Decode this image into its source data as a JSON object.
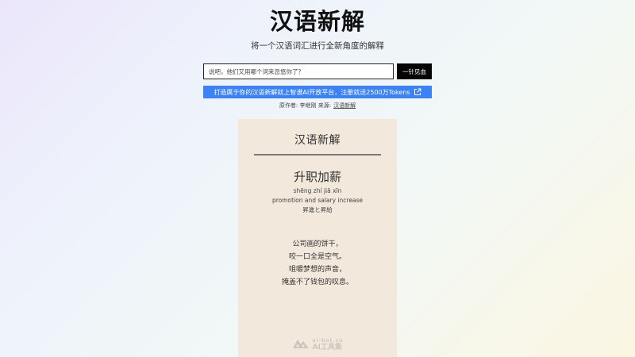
{
  "header": {
    "title": "汉语新解",
    "subtitle": "将一个汉语词汇进行全新角度的解释"
  },
  "search": {
    "placeholder": "说吧，他们又用哪个词来忽悠你了？",
    "button_label": "一针见血"
  },
  "promo": {
    "text": "打造属于你的汉语新解就上智谱AI开放平台，注册就送2500万Tokens",
    "icon": "external-link-icon",
    "color": "#3b82f6"
  },
  "credits": {
    "prefix": "原作者: 李继刚 来源:",
    "link_label": "汉语新解"
  },
  "card": {
    "header": "汉语新解",
    "word": "升职加薪",
    "pinyin": "shēng zhí jiā xīn",
    "english": "promotion and salary increase",
    "japanese": "昇進と昇給",
    "poem": [
      "公司画的饼干，",
      "咬一口全是空气。",
      "咀嚼梦想的声音，",
      "掩盖不了钱包的叹息。"
    ],
    "background": "#f2e8dc"
  },
  "watermark": {
    "url": "ai-bot.cn",
    "name": "AI工具集",
    "icon": "ai-bot-logo-icon"
  }
}
